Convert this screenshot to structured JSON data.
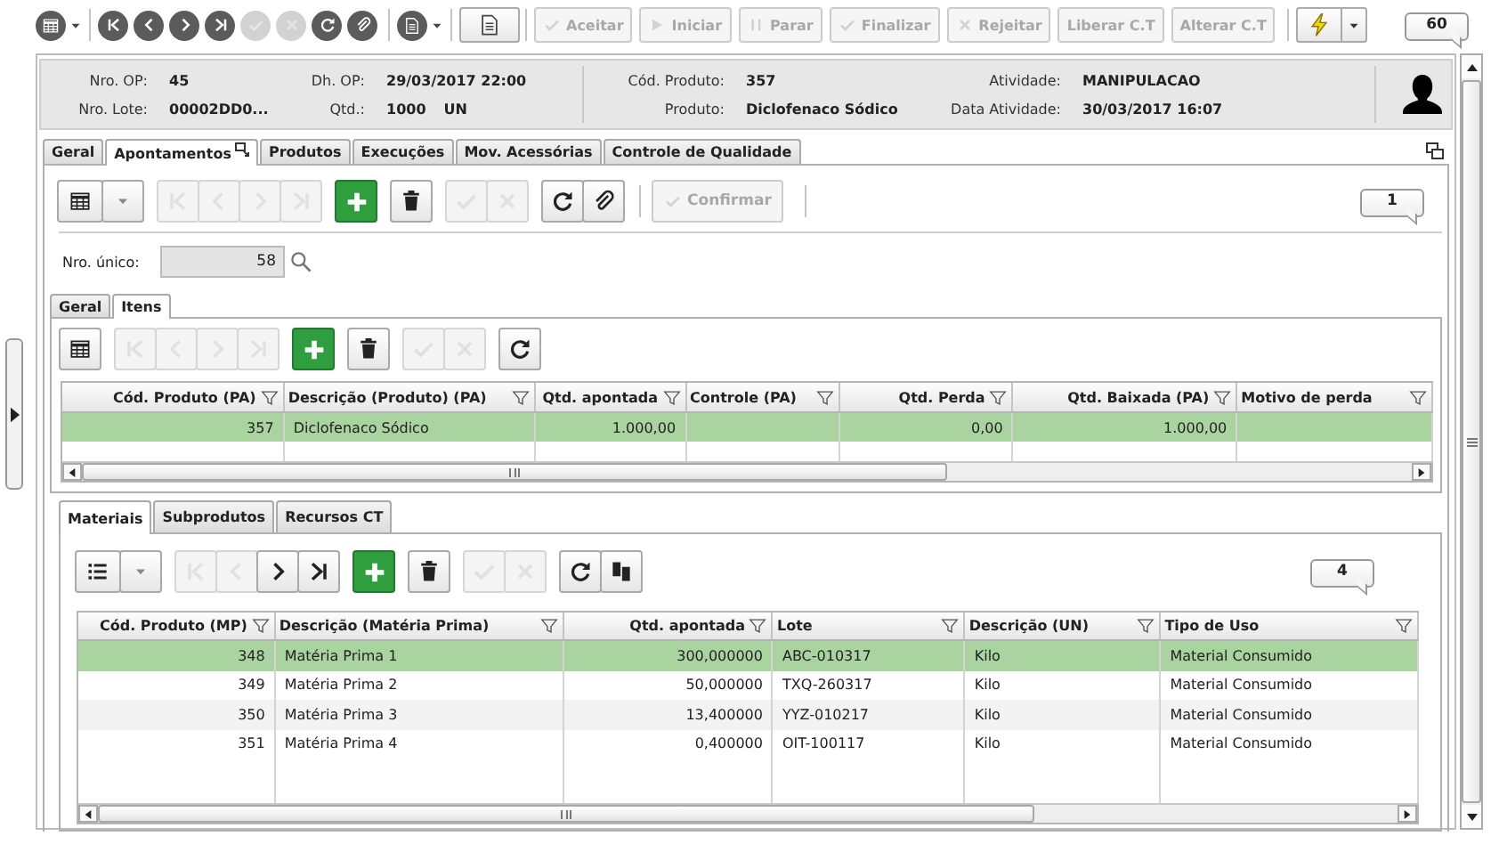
{
  "top_toolbar": {
    "groups": [
      [
        {
          "kind": "grid-menu",
          "disabled": false
        }
      ],
      [
        {
          "kind": "first",
          "disabled": false
        },
        {
          "kind": "prev",
          "disabled": false
        },
        {
          "kind": "next",
          "disabled": false
        },
        {
          "kind": "last",
          "disabled": false
        },
        {
          "kind": "check",
          "disabled": true
        },
        {
          "kind": "cancel",
          "disabled": true
        },
        {
          "kind": "refresh",
          "disabled": false
        },
        {
          "kind": "attach",
          "disabled": false
        }
      ],
      [
        {
          "kind": "print-menu",
          "disabled": false
        }
      ],
      [
        {
          "kind": "report",
          "disabled": false
        }
      ],
      [
        {
          "kind": "accept",
          "label": "Aceitar",
          "disabled": true
        },
        {
          "kind": "start",
          "label": "Iniciar",
          "disabled": true
        },
        {
          "kind": "stop",
          "label": "Parar",
          "disabled": true
        },
        {
          "kind": "finish",
          "label": "Finalizar",
          "disabled": true
        },
        {
          "kind": "reject",
          "label": "Rejeitar",
          "disabled": true
        },
        {
          "kind": "release",
          "label": "Liberar C.T",
          "disabled": true
        },
        {
          "kind": "change",
          "label": "Alterar C.T",
          "disabled": true
        }
      ],
      [
        {
          "kind": "flash-menu",
          "disabled": false
        }
      ]
    ],
    "record_count": "60"
  },
  "header": {
    "columns": [
      [
        {
          "label": "Nro. OP:",
          "value": "45"
        },
        {
          "label": "Nro. Lote:",
          "value": "00002DD0..."
        }
      ],
      [
        {
          "label": "Dh. OP:",
          "value": "29/03/2017 22:00"
        },
        {
          "label": "Qtd.:",
          "value": "1000",
          "unit": "UN"
        }
      ],
      [
        {
          "label": "Cód. Produto:",
          "value": "357"
        },
        {
          "label": "Produto:",
          "value": "Diclofenaco Sódico"
        }
      ],
      [
        {
          "label": "Atividade:",
          "value": "MANIPULACAO"
        },
        {
          "label": "Data Atividade:",
          "value": "30/03/2017 16:07"
        }
      ]
    ]
  },
  "main_tabs": [
    {
      "label": "Geral",
      "selected": false
    },
    {
      "label": "Apontamentos",
      "selected": true
    },
    {
      "label": "Produtos",
      "selected": false
    },
    {
      "label": "Execuções",
      "selected": false
    },
    {
      "label": "Mov. Acessórias",
      "selected": false
    },
    {
      "label": "Controle de Qualidade",
      "selected": false
    }
  ],
  "apontamentos": {
    "toolbar": {
      "groups": [
        [
          {
            "kind": "grid-menu",
            "disabled": false
          }
        ],
        [
          {
            "kind": "first",
            "disabled": true
          },
          {
            "kind": "prev",
            "disabled": true
          },
          {
            "kind": "next",
            "disabled": true
          },
          {
            "kind": "last",
            "disabled": true
          }
        ],
        [
          {
            "kind": "add",
            "disabled": false
          }
        ],
        [
          {
            "kind": "delete",
            "disabled": false
          }
        ],
        [
          {
            "kind": "check",
            "disabled": true
          },
          {
            "kind": "cancel",
            "disabled": true
          }
        ],
        [
          {
            "kind": "refresh",
            "disabled": false
          },
          {
            "kind": "attach",
            "disabled": false
          }
        ],
        [
          {
            "kind": "confirm",
            "label": "Confirmar",
            "disabled": true
          }
        ]
      ],
      "record_count": "1"
    },
    "nro_unico": {
      "label": "Nro. único:",
      "value": "58"
    },
    "sub_tabs": [
      {
        "label": "Geral",
        "selected": false
      },
      {
        "label": "Itens",
        "selected": true
      }
    ],
    "itens": {
      "toolbar": {
        "groups": [
          [
            {
              "kind": "grid",
              "disabled": false
            }
          ],
          [
            {
              "kind": "first",
              "disabled": true
            },
            {
              "kind": "prev",
              "disabled": true
            },
            {
              "kind": "next",
              "disabled": true
            },
            {
              "kind": "last",
              "disabled": true
            }
          ],
          [
            {
              "kind": "add",
              "disabled": false
            }
          ],
          [
            {
              "kind": "delete",
              "disabled": false
            }
          ],
          [
            {
              "kind": "check",
              "disabled": true
            },
            {
              "kind": "cancel",
              "disabled": true
            }
          ],
          [
            {
              "kind": "refresh",
              "disabled": false
            }
          ]
        ]
      },
      "grid": {
        "columns": [
          "Cód. Produto (PA)",
          "Descrição (Produto) (PA)",
          "Qtd. apontada",
          "Controle (PA)",
          "Qtd. Perda",
          "Qtd. Baixada (PA)",
          "Motivo de perda"
        ],
        "rows": [
          {
            "cells": [
              "357",
              "Diclofenaco Sódico",
              "1.000,00",
              null,
              "0,00",
              "1.000,00",
              null
            ],
            "selected": true
          }
        ]
      }
    },
    "lower_tabs": [
      {
        "label": "Materiais",
        "selected": true
      },
      {
        "label": "Subprodutos",
        "selected": false
      },
      {
        "label": "Recursos CT",
        "selected": false
      }
    ],
    "materiais": {
      "toolbar": {
        "groups": [
          [
            {
              "kind": "list-menu",
              "disabled": false
            }
          ],
          [
            {
              "kind": "first",
              "disabled": true
            },
            {
              "kind": "prev",
              "disabled": true
            },
            {
              "kind": "next",
              "disabled": false
            },
            {
              "kind": "last",
              "disabled": false
            }
          ],
          [
            {
              "kind": "add",
              "disabled": false
            }
          ],
          [
            {
              "kind": "delete",
              "disabled": false
            }
          ],
          [
            {
              "kind": "check",
              "disabled": true
            },
            {
              "kind": "cancel",
              "disabled": true
            }
          ],
          [
            {
              "kind": "refresh",
              "disabled": false
            },
            {
              "kind": "copy",
              "disabled": false
            }
          ]
        ],
        "record_count": "4"
      },
      "grid": {
        "columns": [
          "Cód. Produto (MP)",
          "Descrição (Matéria Prima)",
          "Qtd. apontada",
          "Lote",
          "Descrição (UN)",
          "Tipo de Uso"
        ],
        "rows": [
          {
            "cells": [
              "348",
              "Matéria Prima 1",
              "300,000000",
              "ABC-010317",
              "Kilo",
              "Material Consumido"
            ],
            "selected": true
          },
          {
            "cells": [
              "349",
              "Matéria Prima 2",
              "50,000000",
              "TXQ-260317",
              "Kilo",
              "Material Consumido"
            ],
            "selected": false
          },
          {
            "cells": [
              "350",
              "Matéria Prima 3",
              "13,400000",
              "YYZ-010217",
              "Kilo",
              "Material Consumido"
            ],
            "selected": false
          },
          {
            "cells": [
              "351",
              "Matéria Prima 4",
              "0,400000",
              "OIT-100117",
              "Kilo",
              "Material Consumido"
            ],
            "selected": false
          }
        ]
      }
    }
  }
}
